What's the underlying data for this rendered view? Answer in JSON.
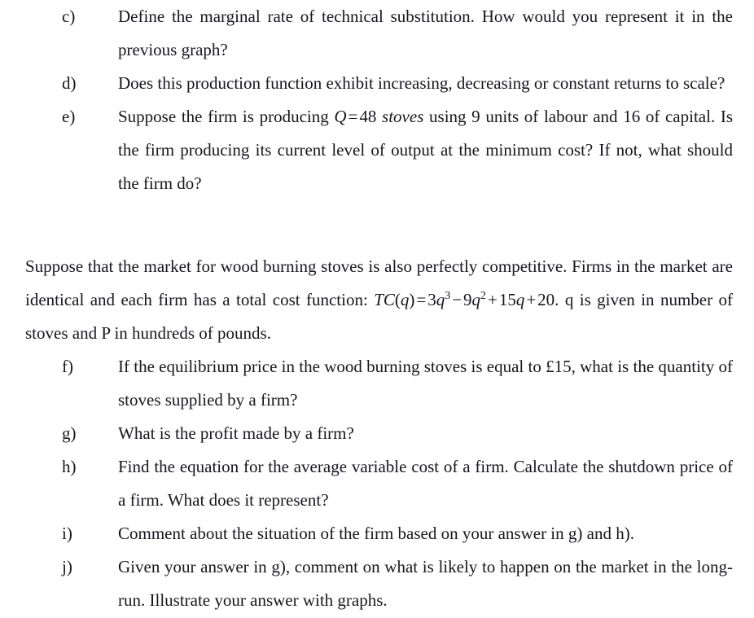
{
  "document": {
    "background_color": "#ffffff",
    "text_color": "#16161e"
  },
  "questions_part1": [
    {
      "label": "c)",
      "text": "Define the marginal rate of technical substitution. How would you represent it in the previous graph?"
    },
    {
      "label": "d)",
      "text": "Does this production function exhibit increasing, decreasing or constant returns to scale?"
    },
    {
      "label": "e)",
      "text_before_math": "Suppose the firm is producing ",
      "math_q": "Q",
      "math_equals": "=",
      "math_value": "48",
      "math_units": "stoves",
      "text_after_math": " using 9 units of labour and 16 of capital. Is the firm producing its current level of output at the minimum cost? If not, what should the firm do?"
    }
  ],
  "paragraph": {
    "line_before_formula": "Suppose that the market for wood burning stoves is also perfectly competitive. Firms in the market are identical and each firm has a total cost function: ",
    "formula": {
      "function_name": "TC",
      "open_paren": "(",
      "argument": "q",
      "close_paren": ")",
      "equals": "=",
      "term1_coeff": "3",
      "term1_var": "q",
      "term1_exp": "3",
      "op1": "−",
      "term2_coeff": "9",
      "term2_var": "q",
      "term2_exp": "2",
      "op2": "+",
      "term3_coeff": "15",
      "term3_var": "q",
      "op3": "+",
      "term4": "20",
      "period": "."
    },
    "line_after_formula": "q is given in number of stoves and P in hundreds of pounds."
  },
  "questions_part2": [
    {
      "label": "f)",
      "text": "If the equilibrium price in the wood burning stoves is equal to £15, what is the quantity of stoves supplied by a firm?"
    },
    {
      "label": "g)",
      "text": "What is the profit made by a firm?"
    },
    {
      "label": "h)",
      "text": "Find the equation for the average variable cost of a firm. Calculate the shutdown price of a firm. What does it represent?"
    },
    {
      "label": "i)",
      "text": "Comment about the situation of the firm based on your answer in g) and h)."
    },
    {
      "label": "j)",
      "text": "Given your answer in g), comment on what is likely to happen on the market in the long-run. Illustrate your answer with graphs."
    }
  ]
}
